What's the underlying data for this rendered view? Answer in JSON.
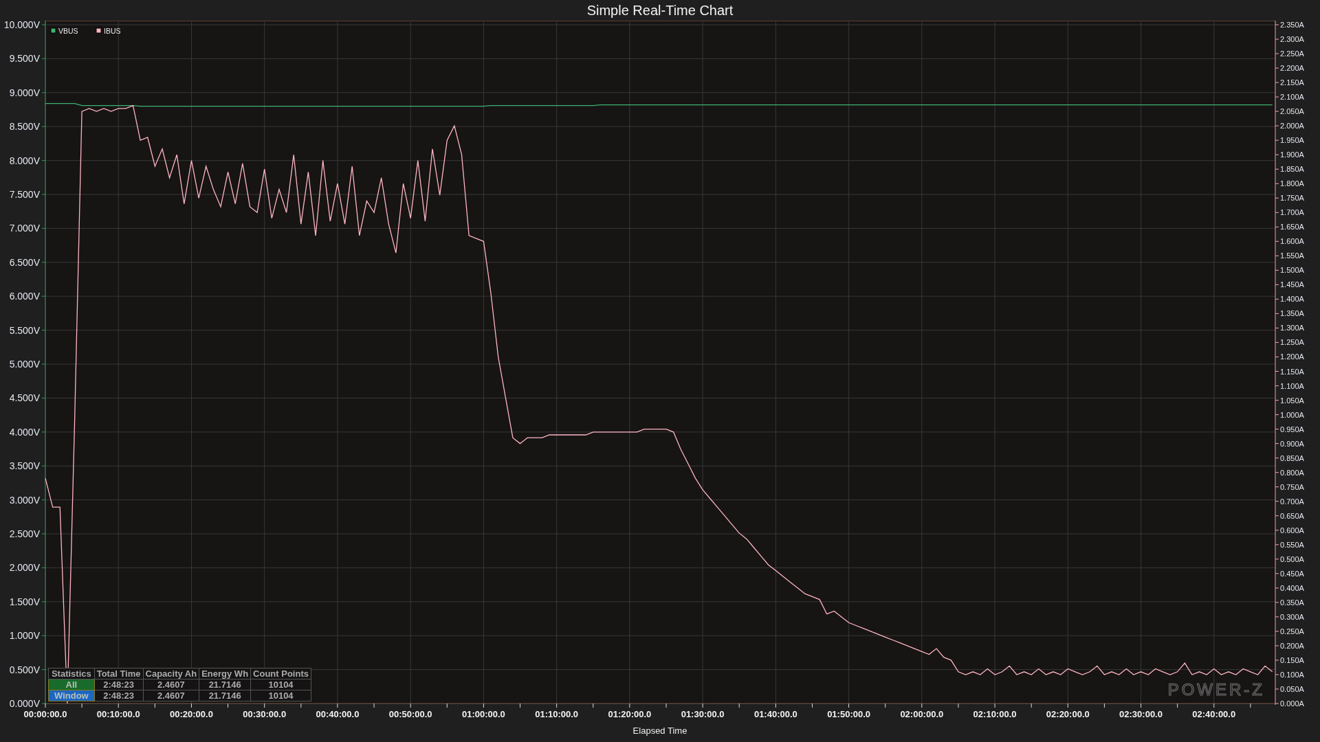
{
  "chart_data": {
    "type": "line",
    "title": "Simple Real-Time Chart",
    "xlabel": "Elapsed Time",
    "categories": [
      "00:00:00.0",
      null,
      null,
      null,
      null,
      null,
      null,
      null,
      null,
      null,
      "00:10:00.0",
      null,
      null,
      null,
      null,
      null,
      null,
      null,
      null,
      null,
      "00:20:00.0",
      null,
      null,
      null,
      null,
      null,
      null,
      null,
      null,
      null,
      "00:30:00.0",
      null,
      null,
      null,
      null,
      null,
      null,
      null,
      null,
      null,
      "00:40:00.0",
      null,
      null,
      null,
      null,
      null,
      null,
      null,
      null,
      null,
      "00:50:00.0",
      null,
      null,
      null,
      null,
      null,
      null,
      null,
      null,
      null,
      "01:00:00.0",
      null,
      null,
      null,
      null,
      null,
      null,
      null,
      null,
      null,
      "01:10:00.0",
      null,
      null,
      null,
      null,
      null,
      null,
      null,
      null,
      null,
      "01:20:00.0",
      null,
      null,
      null,
      null,
      null,
      null,
      null,
      null,
      null,
      "01:30:00.0",
      null,
      null,
      null,
      null,
      null,
      null,
      null,
      null,
      null,
      "01:40:00.0",
      null,
      null,
      null,
      null,
      null,
      null,
      null,
      null,
      null,
      "01:50:00.0",
      null,
      null,
      null,
      null,
      null,
      null,
      null,
      null,
      null,
      "02:00:00.0",
      null,
      null,
      null,
      null,
      null,
      null,
      null,
      null,
      null,
      "02:10:00.0",
      null,
      null,
      null,
      null,
      null,
      null,
      null,
      null,
      null,
      "02:20:00.0",
      null,
      null,
      null,
      null,
      null,
      null,
      null,
      null,
      null,
      "02:30:00.0",
      null,
      null,
      null,
      null,
      null,
      null,
      null,
      null,
      null,
      "02:40:00.0",
      null,
      null,
      null,
      null,
      null,
      null,
      null,
      null
    ],
    "grid": true,
    "legend": true,
    "ylim": [
      0,
      10
    ],
    "y2lim": [
      0,
      2.35
    ],
    "yticks": [
      {
        "value": 0,
        "label": "0.000V"
      },
      {
        "value": 0.5,
        "label": "0.500V"
      },
      {
        "value": 1,
        "label": "1.000V"
      },
      {
        "value": 1.5,
        "label": "1.500V"
      },
      {
        "value": 2,
        "label": "2.000V"
      },
      {
        "value": 2.5,
        "label": "2.500V"
      },
      {
        "value": 3,
        "label": "3.000V"
      },
      {
        "value": 3.5,
        "label": "3.500V"
      },
      {
        "value": 4,
        "label": "4.000V"
      },
      {
        "value": 4.5,
        "label": "4.500V"
      },
      {
        "value": 5,
        "label": "5.000V"
      },
      {
        "value": 5.5,
        "label": "5.500V"
      },
      {
        "value": 6,
        "label": "6.000V"
      },
      {
        "value": 6.5,
        "label": "6.500V"
      },
      {
        "value": 7,
        "label": "7.000V"
      },
      {
        "value": 7.5,
        "label": "7.500V"
      },
      {
        "value": 8,
        "label": "8.000V"
      },
      {
        "value": 8.5,
        "label": "8.500V"
      },
      {
        "value": 9,
        "label": "9.000V"
      },
      {
        "value": 9.5,
        "label": "9.500V"
      },
      {
        "value": 10,
        "label": "10.000V"
      }
    ],
    "y2ticks": [
      {
        "value": 0,
        "label": "0.000A"
      },
      {
        "value": 0.05,
        "label": "0.050A"
      },
      {
        "value": 0.1,
        "label": "0.100A"
      },
      {
        "value": 0.15,
        "label": "0.150A"
      },
      {
        "value": 0.2,
        "label": "0.200A"
      },
      {
        "value": 0.25,
        "label": "0.250A"
      },
      {
        "value": 0.3,
        "label": "0.300A"
      },
      {
        "value": 0.35,
        "label": "0.350A"
      },
      {
        "value": 0.4,
        "label": "0.400A"
      },
      {
        "value": 0.45,
        "label": "0.450A"
      },
      {
        "value": 0.5,
        "label": "0.500A"
      },
      {
        "value": 0.55,
        "label": "0.550A"
      },
      {
        "value": 0.6,
        "label": "0.600A"
      },
      {
        "value": 0.65,
        "label": "0.650A"
      },
      {
        "value": 0.7,
        "label": "0.700A"
      },
      {
        "value": 0.75,
        "label": "0.750A"
      },
      {
        "value": 0.8,
        "label": "0.800A"
      },
      {
        "value": 0.85,
        "label": "0.850A"
      },
      {
        "value": 0.9,
        "label": "0.900A"
      },
      {
        "value": 0.95,
        "label": "0.950A"
      },
      {
        "value": 1,
        "label": "1.000A"
      },
      {
        "value": 1.05,
        "label": "1.050A"
      },
      {
        "value": 1.1,
        "label": "1.100A"
      },
      {
        "value": 1.15,
        "label": "1.150A"
      },
      {
        "value": 1.2,
        "label": "1.200A"
      },
      {
        "value": 1.25,
        "label": "1.250A"
      },
      {
        "value": 1.3,
        "label": "1.300A"
      },
      {
        "value": 1.35,
        "label": "1.350A"
      },
      {
        "value": 1.4,
        "label": "1.400A"
      },
      {
        "value": 1.45,
        "label": "1.450A"
      },
      {
        "value": 1.5,
        "label": "1.500A"
      },
      {
        "value": 1.55,
        "label": "1.550A"
      },
      {
        "value": 1.6,
        "label": "1.600A"
      },
      {
        "value": 1.65,
        "label": "1.650A"
      },
      {
        "value": 1.7,
        "label": "1.700A"
      },
      {
        "value": 1.75,
        "label": "1.750A"
      },
      {
        "value": 1.8,
        "label": "1.800A"
      },
      {
        "value": 1.85,
        "label": "1.850A"
      },
      {
        "value": 1.9,
        "label": "1.900A"
      },
      {
        "value": 1.95,
        "label": "1.950A"
      },
      {
        "value": 2,
        "label": "2.000A"
      },
      {
        "value": 2.05,
        "label": "2.050A"
      },
      {
        "value": 2.1,
        "label": "2.100A"
      },
      {
        "value": 2.15,
        "label": "2.150A"
      },
      {
        "value": 2.2,
        "label": "2.200A"
      },
      {
        "value": 2.25,
        "label": "2.250A"
      },
      {
        "value": 2.3,
        "label": "2.300A"
      },
      {
        "value": 2.35,
        "label": "2.350A"
      }
    ],
    "series": [
      {
        "name": "VBUS",
        "color": "#3cb371",
        "axis": "y",
        "values": [
          8.84,
          8.84,
          8.84,
          8.84,
          8.84,
          8.81,
          8.81,
          8.81,
          8.81,
          8.81,
          8.81,
          8.81,
          8.81,
          8.8,
          8.8,
          8.8,
          8.8,
          8.8,
          8.8,
          8.8,
          8.8,
          8.8,
          8.8,
          8.8,
          8.8,
          8.8,
          8.8,
          8.8,
          8.8,
          8.8,
          8.8,
          8.8,
          8.8,
          8.8,
          8.8,
          8.8,
          8.8,
          8.8,
          8.8,
          8.8,
          8.8,
          8.8,
          8.8,
          8.8,
          8.8,
          8.8,
          8.8,
          8.8,
          8.8,
          8.8,
          8.8,
          8.8,
          8.8,
          8.8,
          8.8,
          8.8,
          8.8,
          8.8,
          8.8,
          8.8,
          8.8,
          8.81,
          8.81,
          8.81,
          8.81,
          8.81,
          8.81,
          8.81,
          8.81,
          8.81,
          8.81,
          8.81,
          8.81,
          8.81,
          8.81,
          8.81,
          8.82,
          8.82,
          8.82,
          8.82,
          8.82,
          8.82,
          8.82,
          8.82,
          8.82,
          8.82,
          8.82,
          8.82,
          8.82,
          8.82,
          8.82,
          8.82,
          8.82,
          8.82,
          8.82,
          8.82,
          8.82,
          8.82,
          8.82,
          8.82,
          8.82,
          8.82,
          8.82,
          8.82,
          8.82,
          8.82,
          8.82,
          8.82,
          8.82,
          8.82,
          8.82,
          8.82,
          8.82,
          8.82,
          8.82,
          8.82,
          8.82,
          8.82,
          8.82,
          8.82,
          8.82,
          8.82,
          8.82,
          8.82,
          8.82,
          8.82,
          8.82,
          8.82,
          8.82,
          8.82,
          8.82,
          8.82,
          8.82,
          8.82,
          8.82,
          8.82,
          8.82,
          8.82,
          8.82,
          8.82,
          8.82,
          8.82,
          8.82,
          8.82,
          8.82,
          8.82,
          8.82,
          8.82,
          8.82,
          8.82,
          8.82,
          8.82,
          8.82,
          8.82,
          8.82,
          8.82,
          8.82,
          8.82,
          8.82,
          8.82,
          8.82,
          8.82,
          8.82,
          8.82,
          8.82,
          8.82,
          8.82,
          8.82,
          8.82
        ]
      },
      {
        "name": "IBUS",
        "color": "#ffb6c1",
        "axis": "y2",
        "values": [
          0.78,
          0.68,
          0.68,
          0,
          0.97,
          2.05,
          2.06,
          2.05,
          2.06,
          2.05,
          2.06,
          2.06,
          2.07,
          1.95,
          1.96,
          1.86,
          1.92,
          1.82,
          1.9,
          1.73,
          1.88,
          1.75,
          1.86,
          1.78,
          1.72,
          1.84,
          1.73,
          1.87,
          1.72,
          1.7,
          1.85,
          1.68,
          1.78,
          1.7,
          1.9,
          1.66,
          1.84,
          1.62,
          1.88,
          1.67,
          1.8,
          1.66,
          1.86,
          1.62,
          1.74,
          1.7,
          1.82,
          1.66,
          1.56,
          1.8,
          1.68,
          1.88,
          1.67,
          1.92,
          1.76,
          1.95,
          2,
          1.9,
          1.62,
          1.61,
          1.6,
          1.42,
          1.2,
          1.06,
          0.92,
          0.9,
          0.92,
          0.92,
          0.92,
          0.93,
          0.93,
          0.93,
          0.93,
          0.93,
          0.93,
          0.94,
          0.94,
          0.94,
          0.94,
          0.94,
          0.94,
          0.94,
          0.95,
          0.95,
          0.95,
          0.95,
          0.94,
          0.88,
          0.83,
          0.78,
          0.74,
          0.71,
          0.68,
          0.65,
          0.62,
          0.59,
          0.57,
          0.54,
          0.51,
          0.48,
          0.46,
          0.44,
          0.42,
          0.4,
          0.38,
          0.37,
          0.36,
          0.31,
          0.32,
          0.3,
          0.28,
          0.27,
          0.26,
          0.25,
          0.24,
          0.23,
          0.22,
          0.21,
          0.2,
          0.19,
          0.18,
          0.17,
          0.19,
          0.16,
          0.15,
          0.11,
          0.1,
          0.11,
          0.1,
          0.12,
          0.1,
          0.11,
          0.13,
          0.1,
          0.11,
          0.1,
          0.12,
          0.1,
          0.11,
          0.1,
          0.12,
          0.11,
          0.1,
          0.11,
          0.13,
          0.1,
          0.11,
          0.1,
          0.12,
          0.1,
          0.11,
          0.1,
          0.12,
          0.11,
          0.1,
          0.11,
          0.14,
          0.1,
          0.11,
          0.1,
          0.12,
          0.1,
          0.11,
          0.1,
          0.12,
          0.11,
          0.1,
          0.13,
          0.11
        ]
      }
    ]
  },
  "statistics": {
    "columns": [
      "Statistics",
      "Total Time",
      "Capacity Ah",
      "Energy Wh",
      "Count Points"
    ],
    "rows": [
      {
        "color": "#196b2c",
        "cells": [
          "All",
          "2:48:23",
          "2.4607",
          "21.7146",
          "10104"
        ]
      },
      {
        "color": "#1c67c2",
        "cells": [
          "Window",
          "2:48:23",
          "2.4607",
          "21.7146",
          "10104"
        ]
      }
    ]
  },
  "logo": "POWER-Z"
}
